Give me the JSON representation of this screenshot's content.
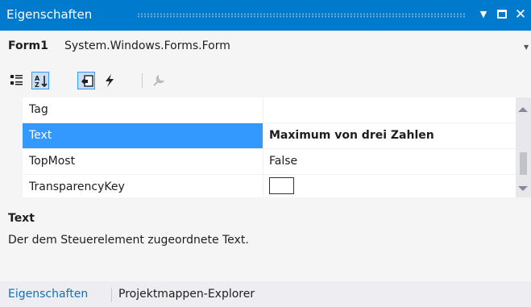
{
  "window": {
    "title": "Eigenschaften",
    "dropdown_icon": "dropdown-arrow-icon",
    "maximize_icon": "maximize-icon",
    "close_icon": "close-icon"
  },
  "object_selector": {
    "name": "Form1",
    "type": "System.Windows.Forms.Form"
  },
  "toolbar": {
    "buttons": [
      {
        "icon": "categorized-icon",
        "selected": false
      },
      {
        "icon": "alphabetical-icon",
        "selected": true
      },
      {
        "icon": "properties-icon",
        "selected": true
      },
      {
        "icon": "events-icon",
        "selected": false
      },
      {
        "icon": "property-pages-icon",
        "selected": false,
        "disabled": true
      }
    ]
  },
  "properties": [
    {
      "name": "Tag",
      "value": ""
    },
    {
      "name": "Text",
      "value": "Maximum von drei Zahlen",
      "selected": true
    },
    {
      "name": "TopMost",
      "value": "False"
    },
    {
      "name": "TransparencyKey",
      "value": "",
      "color_swatch": "#ffffff"
    }
  ],
  "description": {
    "title": "Text",
    "text": "Der dem Steuerelement zugeordnete Text."
  },
  "tabs": [
    {
      "label": "Eigenschaften",
      "active": true
    },
    {
      "label": "Projektmappen-Explorer",
      "active": false
    }
  ],
  "colors": {
    "accent": "#007acc",
    "selection": "#3399ff",
    "tab_active": "#0e70c0"
  }
}
